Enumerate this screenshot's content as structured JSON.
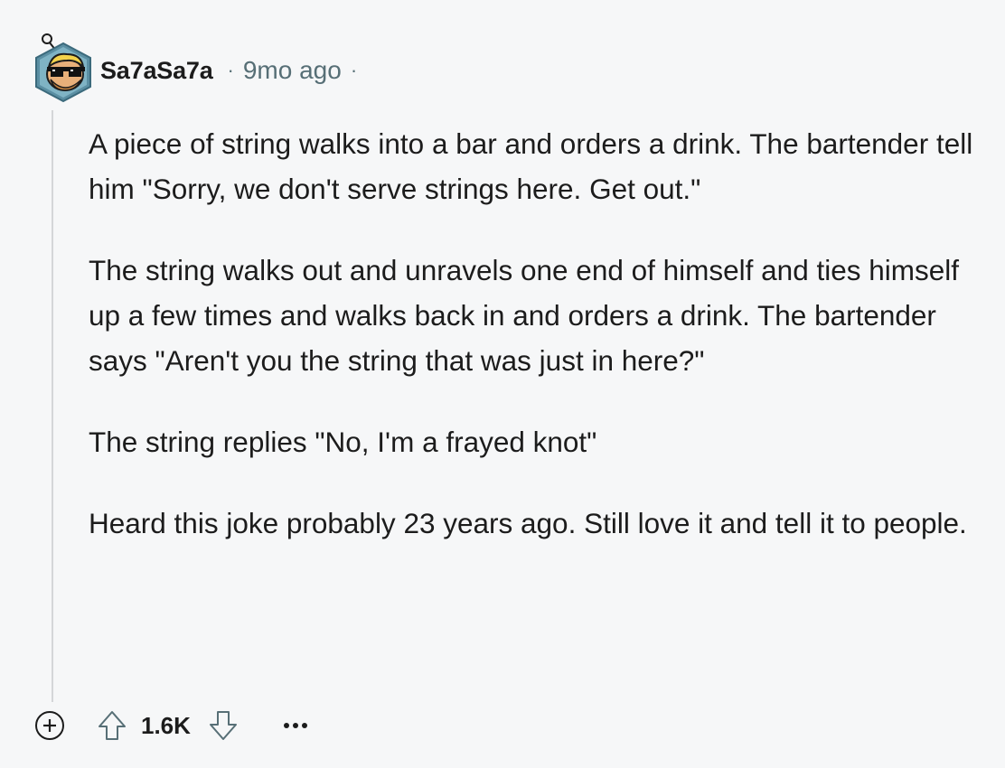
{
  "comment": {
    "username": "Sa7aSa7a",
    "separator": "·",
    "time": "9mo ago",
    "trailing_separator": "·",
    "paragraphs": [
      "A piece of string walks into a bar and orders a drink. The bartender tell him \"Sorry, we don't serve strings here. Get out.\"",
      "The string walks out and unravels one end of himself and ties himself up a few times and walks back in and orders a drink. The bartender says \"Aren't you the string that was just in here?\"",
      "The string replies \"No, I'm a frayed knot\"",
      "Heard this joke probably 23 years ago. Still love it and tell it to people."
    ],
    "score": "1.6K"
  },
  "icons": {
    "expand": "plus-circle-icon",
    "upvote": "arrow-up-outline-icon",
    "downvote": "arrow-down-outline-icon",
    "more": "ellipsis-icon"
  },
  "colors": {
    "background": "#f6f7f8",
    "text": "#1c1c1c",
    "meta": "#576f76",
    "thread_line": "#d4d6d8"
  }
}
